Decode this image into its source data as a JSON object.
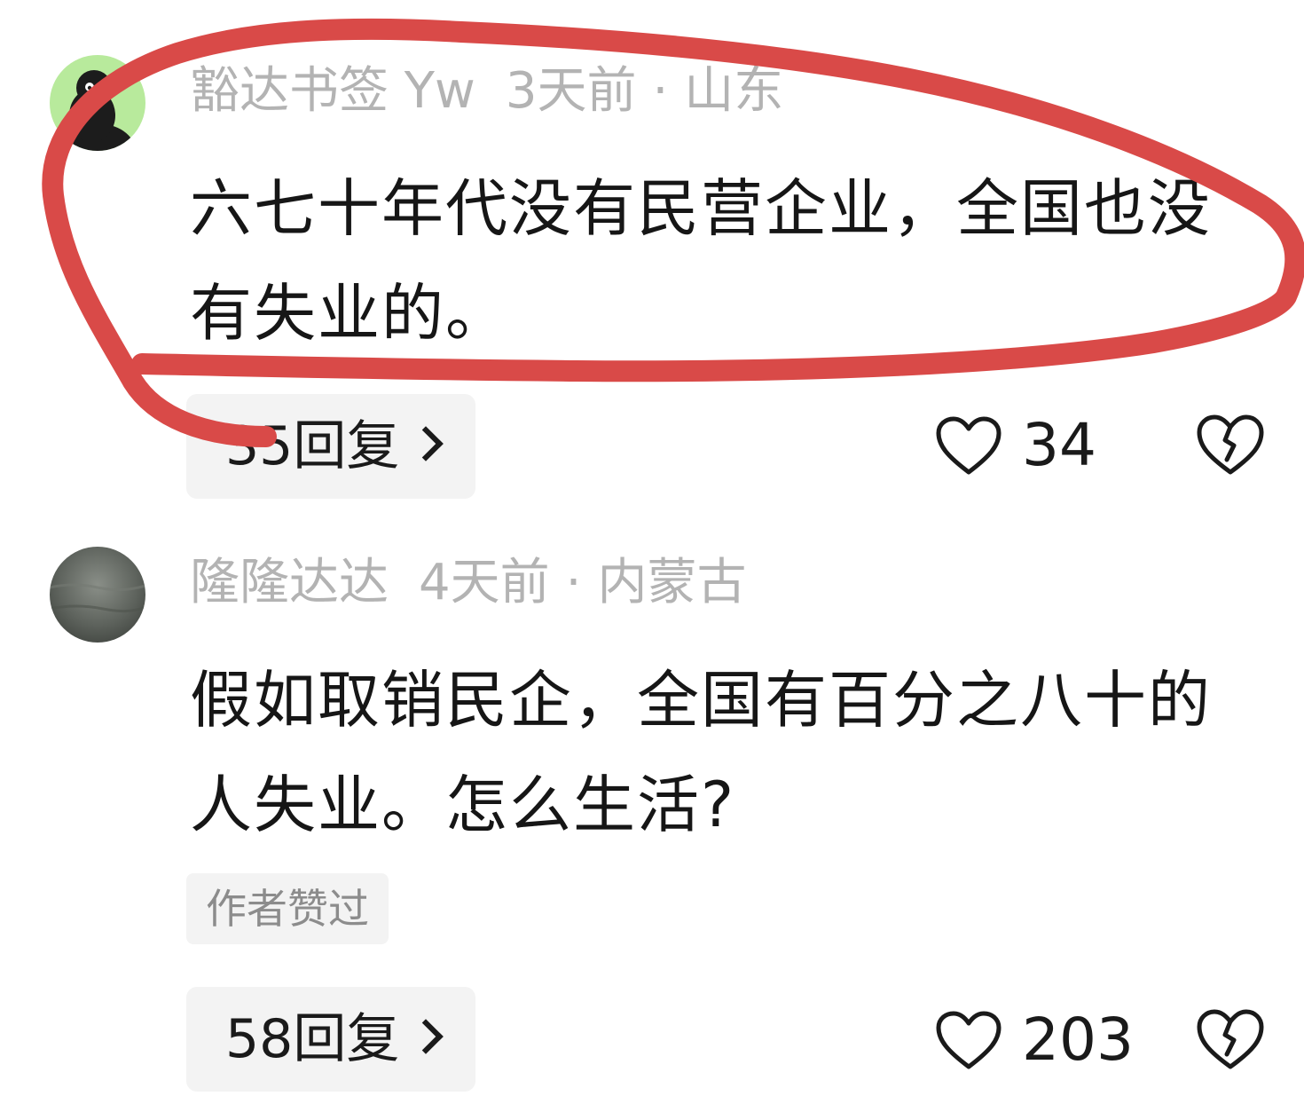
{
  "comments": [
    {
      "username": "豁达书签 Yw",
      "time": "3天前",
      "location": "山东",
      "content": "六七十年代没有民营企业，全国也没有失业的。",
      "replies_label": "35回复",
      "likes": "34",
      "avatar": "cartoon-avatar"
    },
    {
      "username": "隆隆达达",
      "time": "4天前",
      "location": "内蒙古",
      "content": "假如取销民企，全国有百分之八十的人失业。怎么生活?",
      "badge": "作者赞过",
      "replies_label": "58回复",
      "likes": "203",
      "avatar": "gray-photo-avatar"
    }
  ],
  "meta_separator": "·",
  "icons": {
    "like": "heart-outline-icon",
    "dislike": "broken-heart-icon",
    "replies_arrow": "chevron-right-icon"
  },
  "colors": {
    "annotation": "#d94a48",
    "meta_text": "#b3b3b3",
    "chip_bg": "#f3f3f3"
  }
}
